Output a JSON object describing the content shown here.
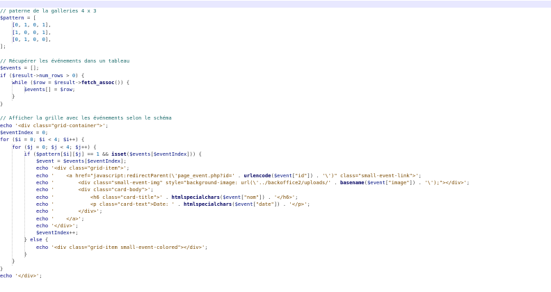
{
  "editor": {
    "lines": [
      [],
      [
        [
          "cm",
          "// paterne de la galleries 4 x 3"
        ]
      ],
      [
        [
          "var",
          "$pattern"
        ],
        [
          "op",
          " = ["
        ]
      ],
      [
        [
          "pl",
          "    ["
        ],
        [
          "num",
          "0"
        ],
        [
          "op",
          ", "
        ],
        [
          "num",
          "1"
        ],
        [
          "op",
          ", "
        ],
        [
          "num",
          "0"
        ],
        [
          "op",
          ", "
        ],
        [
          "num",
          "1"
        ],
        [
          "op",
          "],"
        ]
      ],
      [
        [
          "pl",
          "    ["
        ],
        [
          "num",
          "1"
        ],
        [
          "op",
          ", "
        ],
        [
          "num",
          "0"
        ],
        [
          "op",
          ", "
        ],
        [
          "num",
          "0"
        ],
        [
          "op",
          ", "
        ],
        [
          "num",
          "1"
        ],
        [
          "op",
          "],"
        ]
      ],
      [
        [
          "pl",
          "    ["
        ],
        [
          "num",
          "0"
        ],
        [
          "op",
          ", "
        ],
        [
          "num",
          "1"
        ],
        [
          "op",
          ", "
        ],
        [
          "num",
          "0"
        ],
        [
          "op",
          ", "
        ],
        [
          "num",
          "0"
        ],
        [
          "op",
          "],"
        ]
      ],
      [
        [
          "op",
          "];"
        ]
      ],
      [],
      [
        [
          "cm",
          "// Récupérer les événements dans un tableau"
        ]
      ],
      [
        [
          "var",
          "$events"
        ],
        [
          "op",
          " = [];"
        ]
      ],
      [
        [
          "kw",
          "if"
        ],
        [
          "op",
          " ("
        ],
        [
          "var",
          "$result"
        ],
        [
          "op",
          "->"
        ],
        [
          "var",
          "num_rows"
        ],
        [
          "op",
          " > "
        ],
        [
          "num",
          "0"
        ],
        [
          "op",
          ") {"
        ]
      ],
      [
        [
          "pl",
          "    "
        ],
        [
          "kw",
          "while"
        ],
        [
          "op",
          " ("
        ],
        [
          "var",
          "$row"
        ],
        [
          "op",
          " = "
        ],
        [
          "var",
          "$result"
        ],
        [
          "op",
          "->"
        ],
        [
          "fn",
          "fetch_assoc"
        ],
        [
          "op",
          "()) {"
        ]
      ],
      [
        [
          "pl",
          "        "
        ],
        [
          "var",
          "$events"
        ],
        [
          "op",
          "[] = "
        ],
        [
          "var",
          "$row"
        ],
        [
          "op",
          ";"
        ]
      ],
      [
        [
          "op",
          "    }"
        ]
      ],
      [
        [
          "op",
          "}"
        ]
      ],
      [],
      [
        [
          "cm",
          "// Afficher la grille avec les événements selon le schéma"
        ]
      ],
      [
        [
          "kw",
          "echo"
        ],
        [
          "op",
          " "
        ],
        [
          "str",
          "'<div class=\"grid-container\">'"
        ],
        [
          "op",
          ";"
        ]
      ],
      [
        [
          "var",
          "$eventIndex"
        ],
        [
          "op",
          " = "
        ],
        [
          "num",
          "0"
        ],
        [
          "op",
          ";"
        ]
      ],
      [
        [
          "kw",
          "for"
        ],
        [
          "op",
          " ("
        ],
        [
          "var",
          "$i"
        ],
        [
          "op",
          " = "
        ],
        [
          "num",
          "0"
        ],
        [
          "op",
          "; "
        ],
        [
          "var",
          "$i"
        ],
        [
          "op",
          " < "
        ],
        [
          "num",
          "4"
        ],
        [
          "op",
          "; "
        ],
        [
          "var",
          "$i"
        ],
        [
          "op",
          "++) {"
        ]
      ],
      [
        [
          "pl",
          "    "
        ],
        [
          "kw",
          "for"
        ],
        [
          "op",
          " ("
        ],
        [
          "var",
          "$j"
        ],
        [
          "op",
          " = "
        ],
        [
          "num",
          "0"
        ],
        [
          "op",
          "; "
        ],
        [
          "var",
          "$j"
        ],
        [
          "op",
          " < "
        ],
        [
          "num",
          "4"
        ],
        [
          "op",
          "; "
        ],
        [
          "var",
          "$j"
        ],
        [
          "op",
          "++) {"
        ]
      ],
      [
        [
          "pl",
          "        "
        ],
        [
          "kw",
          "if"
        ],
        [
          "op",
          " ("
        ],
        [
          "var",
          "$pattern"
        ],
        [
          "op",
          "["
        ],
        [
          "var",
          "$i"
        ],
        [
          "op",
          "]["
        ],
        [
          "var",
          "$j"
        ],
        [
          "op",
          "] == "
        ],
        [
          "num",
          "1"
        ],
        [
          "op",
          " && "
        ],
        [
          "fn",
          "isset"
        ],
        [
          "op",
          "("
        ],
        [
          "var",
          "$events"
        ],
        [
          "op",
          "["
        ],
        [
          "var",
          "$eventIndex"
        ],
        [
          "op",
          "])) {"
        ]
      ],
      [
        [
          "pl",
          "            "
        ],
        [
          "var",
          "$event"
        ],
        [
          "op",
          " = "
        ],
        [
          "var",
          "$events"
        ],
        [
          "op",
          "["
        ],
        [
          "var",
          "$eventIndex"
        ],
        [
          "op",
          "];"
        ]
      ],
      [
        [
          "pl",
          "            "
        ],
        [
          "kw",
          "echo"
        ],
        [
          "op",
          " "
        ],
        [
          "str",
          "'<div class=\"grid-item\">'"
        ],
        [
          "op",
          ";"
        ]
      ],
      [
        [
          "pl",
          "            "
        ],
        [
          "kw",
          "echo"
        ],
        [
          "op",
          " "
        ],
        [
          "str",
          "'    <a href=\"javascript:redirectParent(\\'page_event.php?id='"
        ],
        [
          "op",
          " . "
        ],
        [
          "fn",
          "urlencode"
        ],
        [
          "op",
          "("
        ],
        [
          "var",
          "$event"
        ],
        [
          "op",
          "["
        ],
        [
          "str",
          "\"id\""
        ],
        [
          "op",
          "]) . "
        ],
        [
          "str",
          "'\\')\" class=\"small-event-link\">'"
        ],
        [
          "op",
          ";"
        ]
      ],
      [
        [
          "pl",
          "            "
        ],
        [
          "kw",
          "echo"
        ],
        [
          "op",
          " "
        ],
        [
          "str",
          "'        <div class=\"small-event-img\" style=\"background-image: url(\\'../backoffice2/uploads/'"
        ],
        [
          "op",
          " . "
        ],
        [
          "fn",
          "basename"
        ],
        [
          "op",
          "("
        ],
        [
          "var",
          "$event"
        ],
        [
          "op",
          "["
        ],
        [
          "str",
          "\"image\""
        ],
        [
          "op",
          "]) . "
        ],
        [
          "str",
          "'\\');\"></div>'"
        ],
        [
          "op",
          ";"
        ]
      ],
      [
        [
          "pl",
          "            "
        ],
        [
          "kw",
          "echo"
        ],
        [
          "op",
          " "
        ],
        [
          "str",
          "'        <div class=\"card-body\">'"
        ],
        [
          "op",
          ";"
        ]
      ],
      [
        [
          "pl",
          "            "
        ],
        [
          "kw",
          "echo"
        ],
        [
          "op",
          " "
        ],
        [
          "str",
          "'            <h6 class=\"card-title\">'"
        ],
        [
          "op",
          " . "
        ],
        [
          "fn",
          "htmlspecialchars"
        ],
        [
          "op",
          "("
        ],
        [
          "var",
          "$event"
        ],
        [
          "op",
          "["
        ],
        [
          "str",
          "\"nom\""
        ],
        [
          "op",
          "]) . "
        ],
        [
          "str",
          "'</h6>'"
        ],
        [
          "op",
          ";"
        ]
      ],
      [
        [
          "pl",
          "            "
        ],
        [
          "kw",
          "echo"
        ],
        [
          "op",
          " "
        ],
        [
          "str",
          "'            <p class=\"card-text\">Date: '"
        ],
        [
          "op",
          " . "
        ],
        [
          "fn",
          "htmlspecialchars"
        ],
        [
          "op",
          "("
        ],
        [
          "var",
          "$event"
        ],
        [
          "op",
          "["
        ],
        [
          "str",
          "\"date\""
        ],
        [
          "op",
          "]) . "
        ],
        [
          "str",
          "'</p>'"
        ],
        [
          "op",
          ";"
        ]
      ],
      [
        [
          "pl",
          "            "
        ],
        [
          "kw",
          "echo"
        ],
        [
          "op",
          " "
        ],
        [
          "str",
          "'        </div>'"
        ],
        [
          "op",
          ";"
        ]
      ],
      [
        [
          "pl",
          "            "
        ],
        [
          "kw",
          "echo"
        ],
        [
          "op",
          " "
        ],
        [
          "str",
          "'    </a>'"
        ],
        [
          "op",
          ";"
        ]
      ],
      [
        [
          "pl",
          "            "
        ],
        [
          "kw",
          "echo"
        ],
        [
          "op",
          " "
        ],
        [
          "str",
          "'</div>'"
        ],
        [
          "op",
          ";"
        ]
      ],
      [
        [
          "pl",
          "            "
        ],
        [
          "var",
          "$eventIndex"
        ],
        [
          "op",
          "++;"
        ]
      ],
      [
        [
          "pl",
          "        "
        ],
        [
          "op",
          "} "
        ],
        [
          "kw",
          "else"
        ],
        [
          "op",
          " {"
        ]
      ],
      [
        [
          "pl",
          "            "
        ],
        [
          "kw",
          "echo"
        ],
        [
          "op",
          " "
        ],
        [
          "str",
          "'<div class=\"grid-item small-event-colored\"></div>'"
        ],
        [
          "op",
          ";"
        ]
      ],
      [
        [
          "op",
          "        }"
        ]
      ],
      [
        [
          "op",
          "    }"
        ]
      ],
      [
        [
          "op",
          "}"
        ]
      ],
      [
        [
          "kw",
          "echo"
        ],
        [
          "op",
          " "
        ],
        [
          "str",
          "'</div>'"
        ],
        [
          "op",
          ";"
        ]
      ]
    ]
  }
}
